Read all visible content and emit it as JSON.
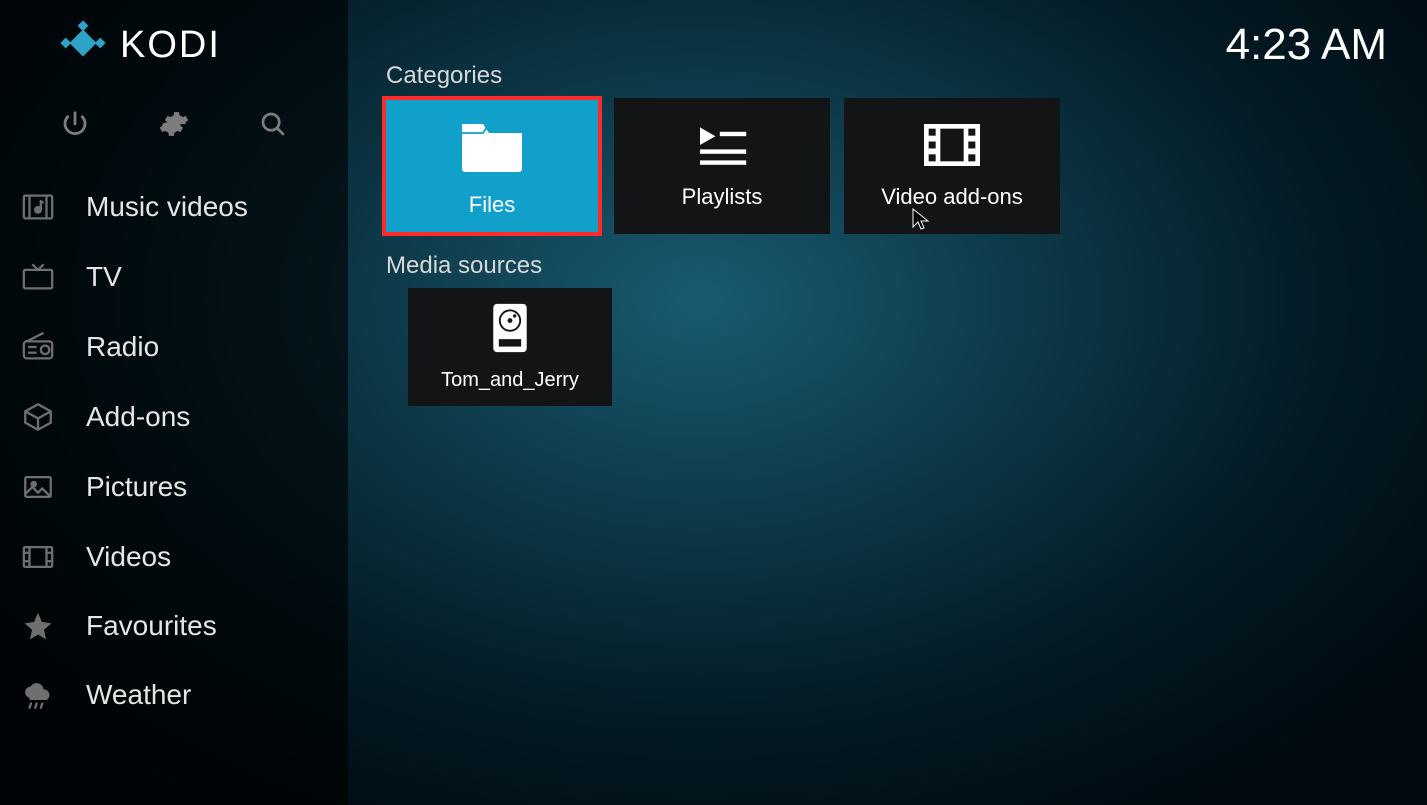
{
  "brand": {
    "name": "KODI"
  },
  "clock": "4:23 AM",
  "toolbar": {
    "power": "power-icon",
    "settings": "gear-icon",
    "search": "search-icon"
  },
  "menu": [
    {
      "id": "music-videos",
      "label": "Music videos",
      "icon": "music-video-icon"
    },
    {
      "id": "tv",
      "label": "TV",
      "icon": "tv-icon"
    },
    {
      "id": "radio",
      "label": "Radio",
      "icon": "radio-icon"
    },
    {
      "id": "addons",
      "label": "Add-ons",
      "icon": "addons-icon"
    },
    {
      "id": "pictures",
      "label": "Pictures",
      "icon": "pictures-icon"
    },
    {
      "id": "videos",
      "label": "Videos",
      "icon": "videos-icon"
    },
    {
      "id": "favourites",
      "label": "Favourites",
      "icon": "star-icon"
    },
    {
      "id": "weather",
      "label": "Weather",
      "icon": "weather-icon"
    }
  ],
  "sections": {
    "categories_title": "Categories",
    "media_title": "Media sources",
    "categories": [
      {
        "id": "files",
        "label": "Files",
        "icon": "folder-icon",
        "selected": true
      },
      {
        "id": "playlists",
        "label": "Playlists",
        "icon": "playlist-icon",
        "selected": false
      },
      {
        "id": "addons",
        "label": "Video add-ons",
        "icon": "film-icon",
        "selected": false
      }
    ],
    "media_sources": [
      {
        "id": "tom-jerry",
        "label": "Tom_and_Jerry",
        "icon": "disk-icon"
      }
    ]
  }
}
